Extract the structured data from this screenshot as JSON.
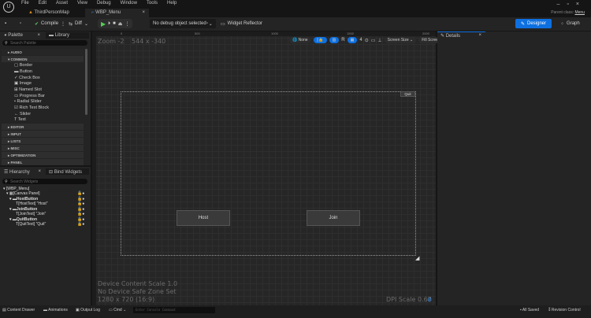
{
  "menu": [
    "File",
    "Edit",
    "Asset",
    "View",
    "Debug",
    "Window",
    "Tools",
    "Help"
  ],
  "tabs": [
    {
      "label": "ThirdPersonMap"
    },
    {
      "label": "WBP_Menu"
    }
  ],
  "parent_class": {
    "label": "Parent class:",
    "value": "Menu"
  },
  "toolbar": {
    "compile": "Compile",
    "diff": "Diff",
    "debug_object": "No debug object selected",
    "widget_reflector": "Widget Reflector",
    "designer": "Designer",
    "graph": "Graph"
  },
  "palette": {
    "tab": "Palette",
    "library_tab": "Library",
    "search_placeholder": "Search Palette",
    "categories_top": [
      "AUDIO",
      "COMMON"
    ],
    "common_items": [
      "Border",
      "Button",
      "Check Box",
      "Image",
      "Named Slot",
      "Progress Bar",
      "Radial Slider",
      "Rich Text Block",
      "Slider",
      "Text"
    ],
    "categories_bottom": [
      "EDITOR",
      "INPUT",
      "LISTS",
      "MISC",
      "OPTIMIZATION",
      "PANEL"
    ]
  },
  "hierarchy": {
    "tab": "Hierarchy",
    "bind_tab": "Bind Widgets",
    "search_placeholder": "Search Widgets",
    "nodes": [
      "[WBP_Menu]",
      "[Canvas Panel]",
      "HostButton",
      "[HostText] \"Host\"",
      "JoinButton",
      "[JoinText] \"Join\"",
      "QuitButton",
      "[QuitText] \"Quit\""
    ]
  },
  "canvas": {
    "zoom": "Zoom -2",
    "size": "544 x -340",
    "ruler": [
      "0",
      "500",
      "1000",
      "1500",
      "2000"
    ],
    "none": "None",
    "r": "R",
    "grid": "4",
    "screen_size": "Screen Size",
    "fill_screen": "Fill Screen",
    "buttons": {
      "host": "Host",
      "join": "Join",
      "quit": "Quit"
    },
    "info": [
      "Device Content Scale 1.0",
      "No Device Safe Zone Set",
      "1280 x 720 (16:9)"
    ],
    "dpi": "DPI Scale 0.67"
  },
  "details": {
    "tab": "Details"
  },
  "statusbar": {
    "content_drawer": "Content Drawer",
    "animations": "Animations",
    "output_log": "Output Log",
    "cmd": "Cmd",
    "console_placeholder": "Enter Console Command",
    "all_saved": "All Saved",
    "revision_control": "Revision Control"
  },
  "colors": {
    "accent": "#0e70e0"
  }
}
